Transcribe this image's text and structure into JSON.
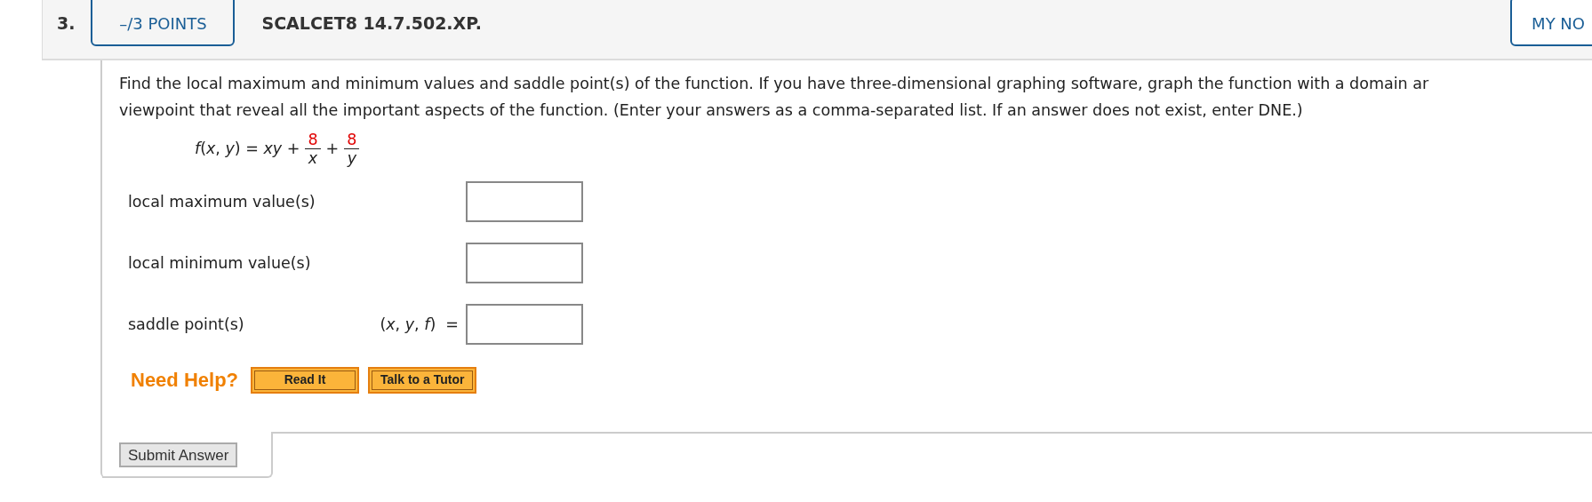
{
  "question": {
    "number": "3.",
    "points": "–/3 POINTS",
    "code": "SCALCET8 14.7.502.XP.",
    "notes_button": "MY NO"
  },
  "prompt_lines": [
    "Find the local maximum and minimum values and saddle point(s) of the function. If you have three-dimensional graphing software, graph the function with a domain ar",
    "viewpoint that reveal all the important aspects of the function. (Enter your answers as a comma-separated list. If an answer does not exist, enter DNE.)"
  ],
  "formula": [
    {
      "kind": "text",
      "text": "*f*(*x*, *y*) = *xy* +"
    },
    {
      "kind": "fraction",
      "numerator": "8",
      "denominator": "x"
    },
    {
      "kind": "text",
      "text": "+"
    },
    {
      "kind": "fraction",
      "numerator": "8",
      "denominator": "y"
    }
  ],
  "answers": [
    {
      "label": "local maximum value(s)"
    },
    {
      "label": "local minimum value(s)"
    },
    {
      "label": "saddle point(s)",
      "prefix": "(*x*, *y*, *f*)  ="
    }
  ],
  "help": {
    "label": "Need Help?",
    "buttons": [
      "Read It",
      "Talk to a Tutor"
    ]
  },
  "submit": "Submit Answer"
}
